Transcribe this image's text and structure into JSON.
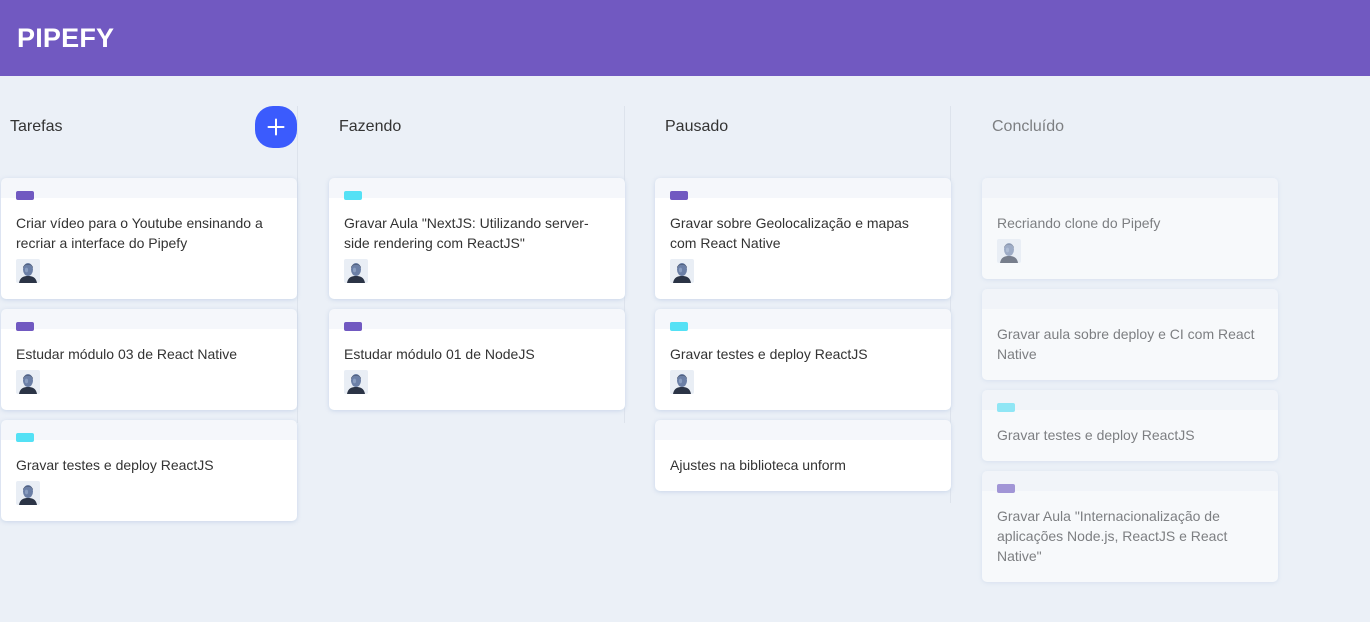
{
  "app": {
    "logo": "PIPEFY"
  },
  "colors": {
    "header": "#7159c1",
    "purple": "#7159c1",
    "cyan": "#54e1f5",
    "add_button": "#3b5bfd"
  },
  "lists": [
    {
      "title": "Tarefas",
      "creatable": true,
      "add_icon": "plus-icon",
      "cards": [
        {
          "label": "#7159c1",
          "content": "Criar vídeo para o Youtube ensinando a recriar a interface do Pipefy",
          "user": true
        },
        {
          "label": "#7159c1",
          "content": "Estudar módulo 03 de React Native",
          "user": true
        },
        {
          "label": "#54e1f5",
          "content": "Gravar testes e deploy ReactJS",
          "user": true
        }
      ]
    },
    {
      "title": "Fazendo",
      "cards": [
        {
          "label": "#54e1f5",
          "content": "Gravar Aula \"NextJS: Utilizando server-side rendering com ReactJS\"",
          "user": true
        },
        {
          "label": "#7159c1",
          "content": "Estudar módulo 01 de NodeJS",
          "user": true
        }
      ]
    },
    {
      "title": "Pausado",
      "cards": [
        {
          "label": "#7159c1",
          "content": "Gravar sobre Geolocalização e mapas com React Native",
          "user": true
        },
        {
          "label": "#54e1f5",
          "content": "Gravar testes e deploy ReactJS",
          "user": true
        },
        {
          "label": "",
          "content": "Ajustes na biblioteca unform",
          "user": false
        }
      ]
    },
    {
      "title": "Concluído",
      "done": true,
      "cards": [
        {
          "label": "",
          "content": "Recriando clone do Pipefy",
          "user": true
        },
        {
          "label": "",
          "content": "Gravar aula sobre deploy e CI com React Native",
          "user": false
        },
        {
          "label": "#54e1f5",
          "content": "Gravar testes e deploy ReactJS",
          "user": false
        },
        {
          "label": "#7159c1",
          "content": "Gravar Aula \"Internacionalização de aplicações Node.js, ReactJS e React Native\"",
          "user": false
        }
      ]
    }
  ]
}
